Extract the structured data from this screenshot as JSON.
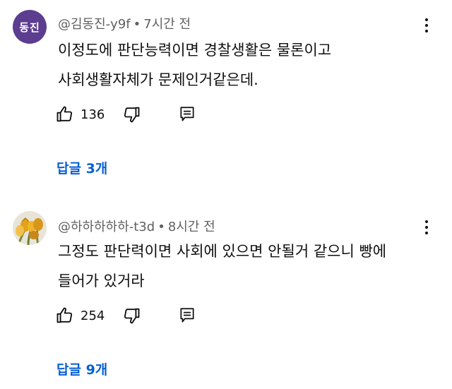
{
  "colors": {
    "link": "#065fd4",
    "meta": "#606060",
    "avatar_1_bg": "#5c3d8f"
  },
  "comments": [
    {
      "avatar_text": "동진",
      "author": "@김동진-y9f",
      "separator": "•",
      "time": "7시간 전",
      "text": "이정도에 판단능력이면 경찰생활은 물론이고\n사회생활자체가 문제인거같은데.",
      "likes": "136",
      "replies_label": "답글 3개",
      "icons": [
        "thumbs-up-icon",
        "thumbs-down-icon",
        "reply-icon",
        "more-vert-icon"
      ]
    },
    {
      "avatar_text": "",
      "author": "@하하하하하-t3d",
      "separator": "•",
      "time": "8시간 전",
      "text": "그정도 판단력이면 사회에 있으면 안될거 같으니 빵에\n들어가 있거라",
      "likes": "254",
      "replies_label": "답글 9개",
      "icons": [
        "thumbs-up-icon",
        "thumbs-down-icon",
        "reply-icon",
        "more-vert-icon"
      ]
    }
  ]
}
